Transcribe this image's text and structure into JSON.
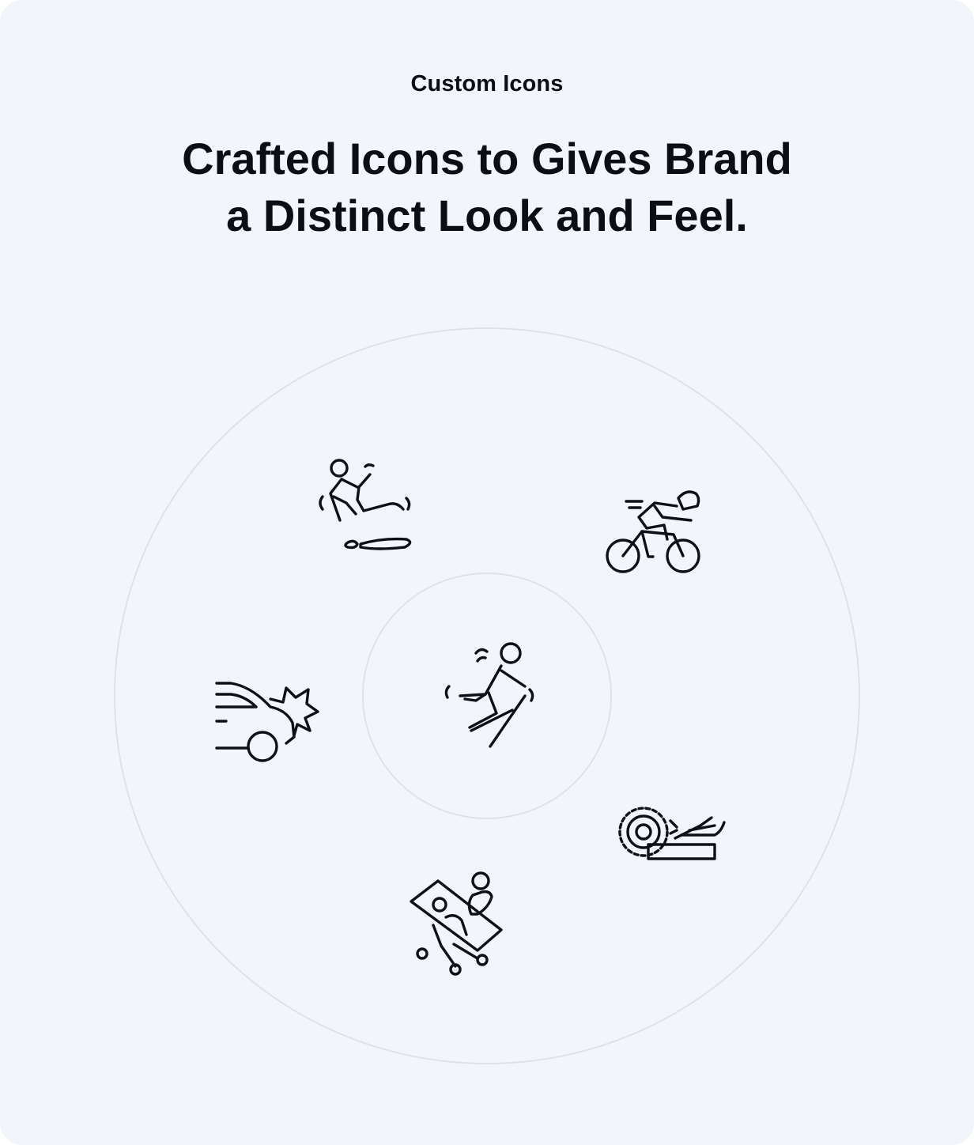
{
  "section": {
    "eyebrow": "Custom Icons",
    "headline_line1": "Crafted Icons to Gives Brand",
    "headline_line2": "a Distinct Look and Feel."
  },
  "icons": [
    {
      "name": "slip-and-fall-icon"
    },
    {
      "name": "cyclist-icon"
    },
    {
      "name": "falling-person-icon"
    },
    {
      "name": "car-crash-icon"
    },
    {
      "name": "saw-hand-injury-icon"
    },
    {
      "name": "stretcher-patient-icon"
    }
  ],
  "colors": {
    "background": "#f2f6fa",
    "text": "#0b0f14",
    "icon_stroke": "#0d1117",
    "orbit_line": "#dfe3e8"
  }
}
